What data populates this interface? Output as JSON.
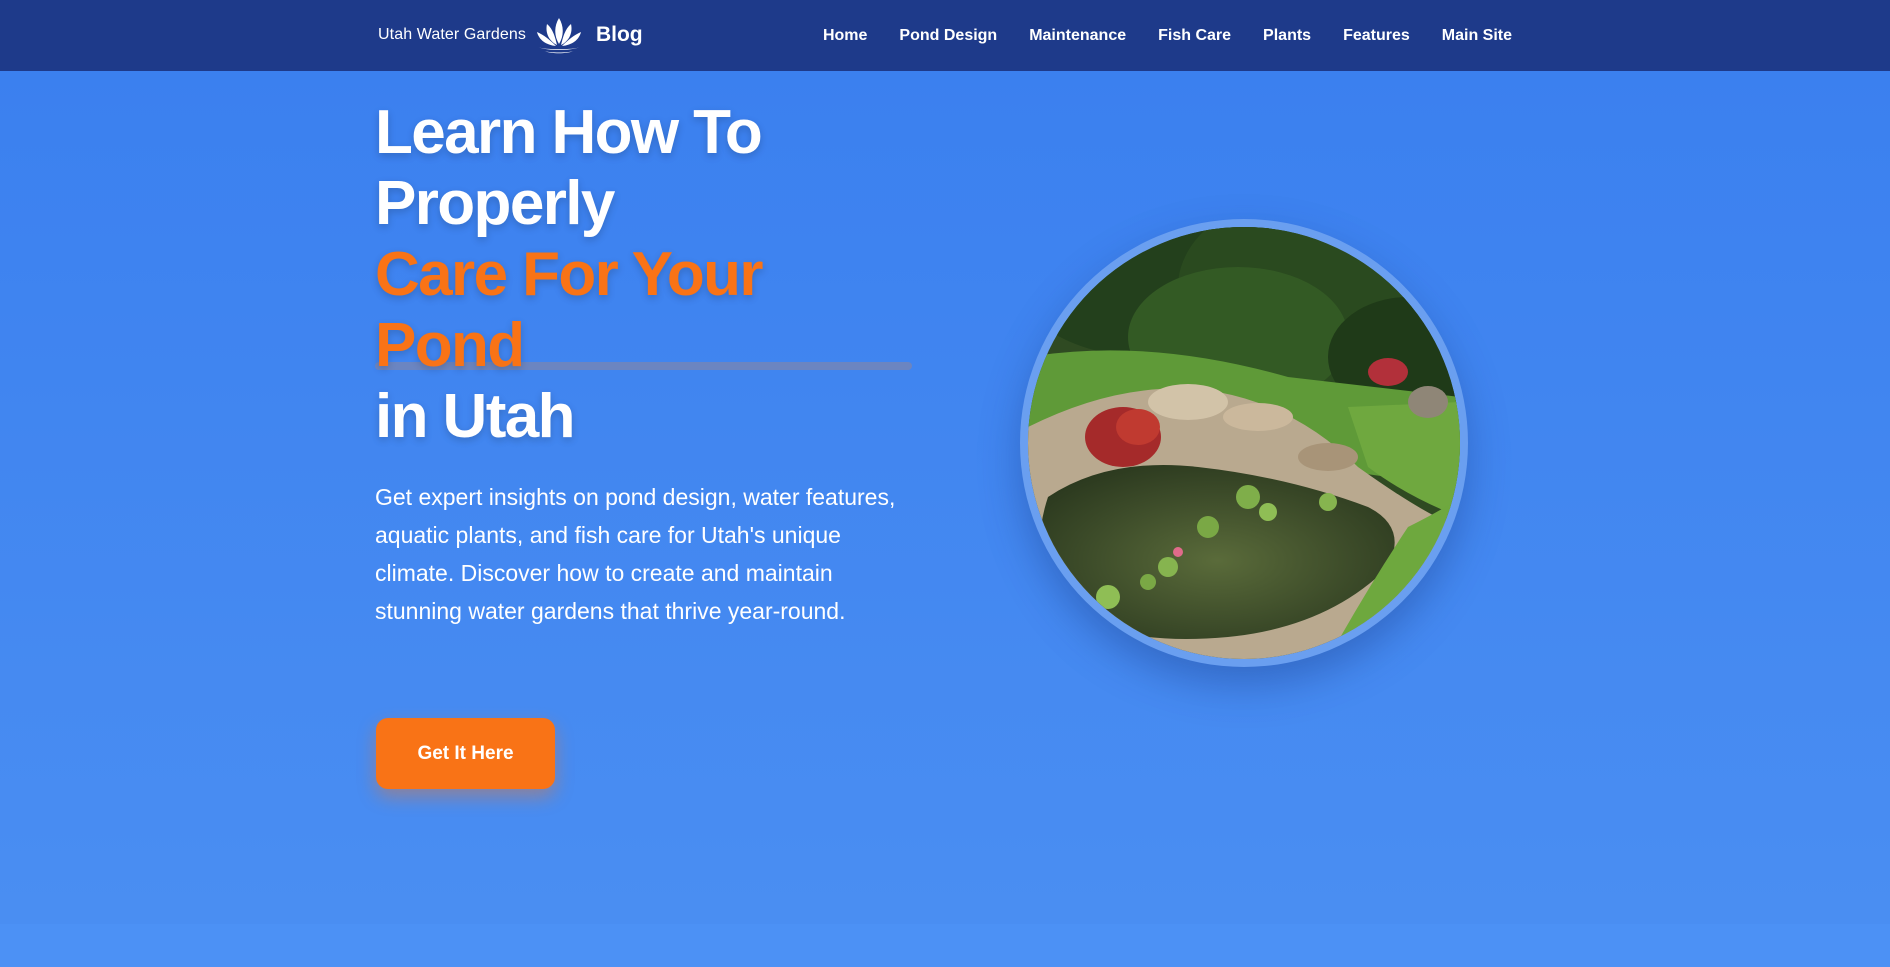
{
  "brand": {
    "logo_text": "Utah Water Gardens",
    "blog_label": "Blog",
    "logo_icon": "lotus-icon"
  },
  "nav": {
    "links": [
      {
        "label": "Home"
      },
      {
        "label": "Pond Design"
      },
      {
        "label": "Maintenance"
      },
      {
        "label": "Fish Care"
      },
      {
        "label": "Plants"
      },
      {
        "label": "Features"
      },
      {
        "label": "Main Site"
      }
    ]
  },
  "hero": {
    "headline_line1": "Learn How To",
    "headline_line2": "Properly",
    "headline_line3": "Care For Your",
    "headline_line4": "Pond",
    "headline_line5": "in Utah",
    "lead": "Get expert insights on pond design, water features, aquatic plants, and fish care for Utah's unique climate. Discover how to create and maintain stunning water gardens that thrive year-round.",
    "cta_label": "Get It Here"
  },
  "colors": {
    "nav_bg": "#1e3a8a",
    "hero_bg": "#3b82f6",
    "accent": "#f97316",
    "text": "#ffffff"
  }
}
